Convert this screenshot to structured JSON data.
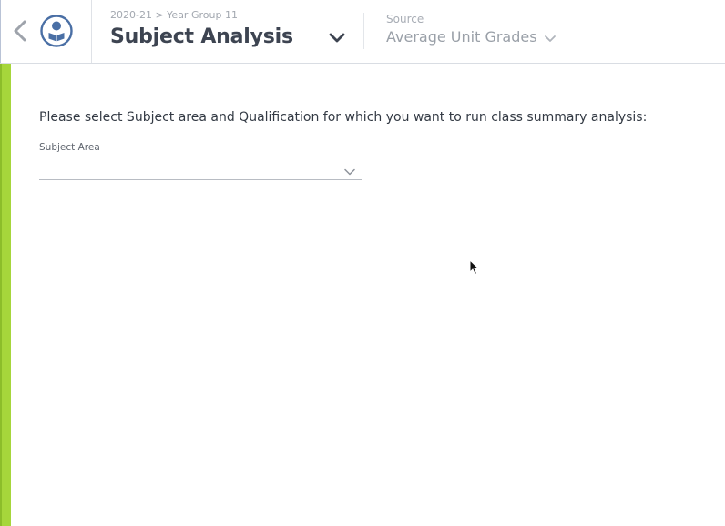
{
  "header": {
    "breadcrumb": "2020-21 > Year Group 11",
    "title": "Subject Analysis",
    "source_label": "Source",
    "source_value": "Average Unit Grades"
  },
  "main": {
    "instruction": "Please select Subject area and Qualification for which you want to run class summary analysis:",
    "subject_area": {
      "label": "Subject Area",
      "value": ""
    }
  },
  "icons": {
    "back": "chevron-left-icon",
    "logo": "student-reading-icon",
    "title_dropdown": "chevron-down-icon",
    "source_dropdown": "chevron-down-icon",
    "subject_dropdown": "chevron-down-icon",
    "cursor": "mouse-pointer-icon"
  },
  "colors": {
    "accent": "#a6d63b",
    "logo_blue": "#4a6fa5",
    "title_text": "#3d4451"
  }
}
